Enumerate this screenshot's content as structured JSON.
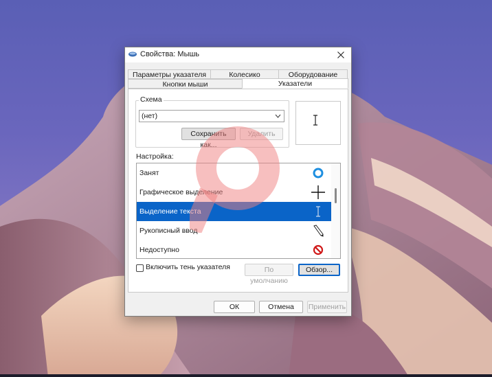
{
  "window": {
    "title": "Свойства: Мышь",
    "close_icon": "close-icon"
  },
  "tabs": {
    "row_top": [
      "Параметры указателя",
      "Колесико",
      "Оборудование"
    ],
    "row_bottom": [
      "Кнопки мыши",
      "Указатели"
    ],
    "active": "Указатели"
  },
  "scheme": {
    "group_label": "Схема",
    "selected_value": "(нет)",
    "save_as_label": "Сохранить как...",
    "delete_label": "Удалить"
  },
  "customize": {
    "label": "Настройка:",
    "items": [
      {
        "label": "Занят",
        "icon": "busy-ring-icon"
      },
      {
        "label": "Графическое выделение",
        "icon": "crosshair-icon"
      },
      {
        "label": "Выделение текста",
        "icon": "text-beam-icon",
        "selected": true
      },
      {
        "label": "Рукописный ввод",
        "icon": "pen-icon"
      },
      {
        "label": "Недоступно",
        "icon": "unavailable-icon"
      }
    ]
  },
  "shadow_checkbox": {
    "label": "Включить тень указателя",
    "checked": false
  },
  "buttons": {
    "default_label": "По умолчанию",
    "browse_label": "Обзор...",
    "ok_label": "ОК",
    "cancel_label": "Отмена",
    "apply_label": "Применить"
  },
  "colors": {
    "selection": "#0a64c8",
    "watermark": "#f08080"
  }
}
